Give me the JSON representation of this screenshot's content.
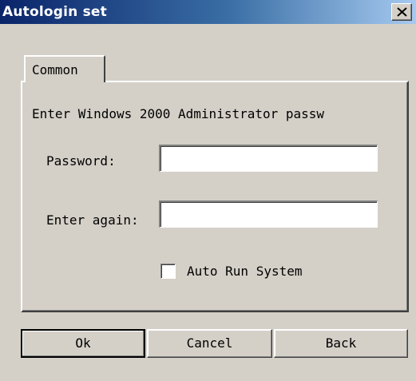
{
  "window": {
    "title": "Autologin set"
  },
  "tabs": [
    {
      "label": "Common"
    }
  ],
  "panel": {
    "instruction": "Enter Windows 2000 Administrator passw",
    "password_label": "Password:",
    "password_value": "",
    "confirm_label": "Enter again:",
    "confirm_value": "",
    "auto_run_label": "Auto Run System",
    "auto_run_checked": false
  },
  "buttons": {
    "ok": "Ok",
    "cancel": "Cancel",
    "back": "Back"
  },
  "icons": {
    "close": "close-icon"
  },
  "colors": {
    "titlebar_start": "#0a246a",
    "titlebar_end": "#a6caf0",
    "face": "#d4d0c8"
  }
}
